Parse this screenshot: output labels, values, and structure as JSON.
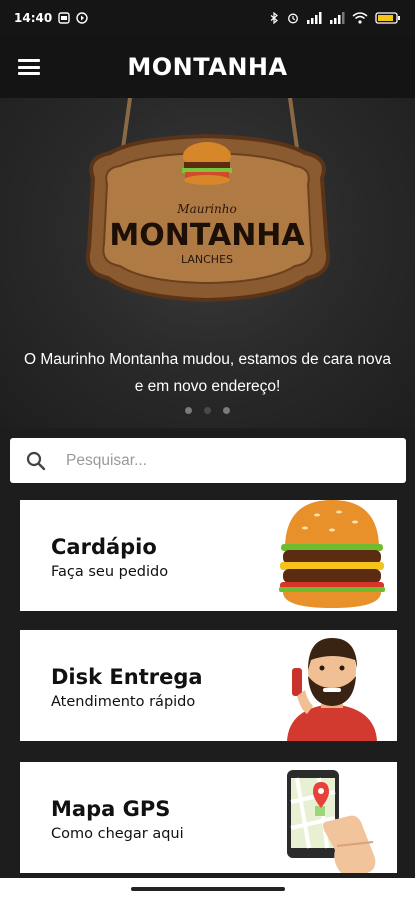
{
  "status_bar": {
    "time": "14:40",
    "battery_icon": "battery-icon"
  },
  "app_bar": {
    "title": "MONTANHA",
    "menu_icon": "menu-icon"
  },
  "hero": {
    "sign": {
      "line1": "Maurinho",
      "line2": "MONTANHA",
      "line3": "LANCHES"
    },
    "message": "O Maurinho Montanha mudou, estamos de cara nova e em novo endereço!",
    "carousel": {
      "count": 3,
      "active_index": 1
    }
  },
  "search": {
    "placeholder": "Pesquisar...",
    "value": ""
  },
  "cards": [
    {
      "title": "Cardápio",
      "subtitle": "Faça seu pedido",
      "icon": "burger-icon"
    },
    {
      "title": "Disk Entrega",
      "subtitle": "Atendimento rápido",
      "icon": "delivery-person-icon"
    },
    {
      "title": "Mapa GPS",
      "subtitle": "Como chegar aqui",
      "icon": "map-phone-icon"
    }
  ],
  "colors": {
    "background": "#1d1d1d",
    "appbar": "#141414",
    "card": "#ffffff",
    "accent": "#f2a21d"
  }
}
